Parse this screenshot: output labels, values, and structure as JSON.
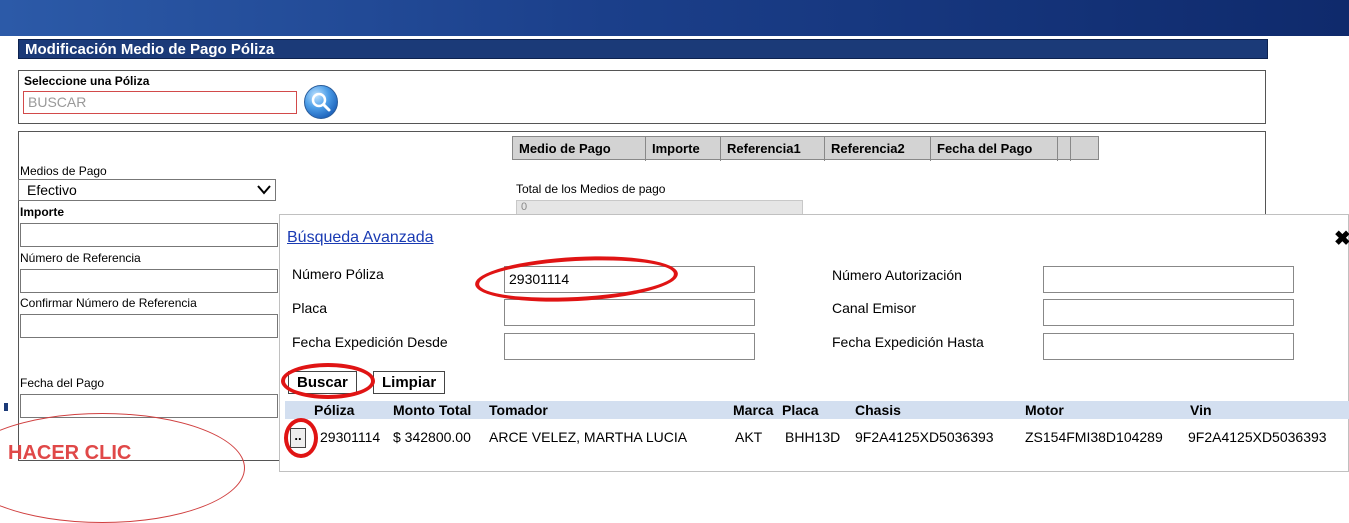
{
  "page_title": "Modificación Medio de Pago Póliza",
  "poliza_select": {
    "label": "Seleccione una Póliza",
    "value": "BUSCAR"
  },
  "left_form": {
    "medios_label": "Medios de Pago",
    "medios_value": "Efectivo",
    "importe_label": "Importe",
    "num_ref_label": "Número de Referencia",
    "confirm_ref_label": "Confirmar Número de Referencia",
    "fecha_label": "Fecha del Pago"
  },
  "payments_table": {
    "headers": [
      "Medio de Pago",
      "Importe",
      "Referencia1",
      "Referencia2",
      "Fecha del Pago"
    ],
    "total_label": "Total de los Medios de pago",
    "total_value": "0"
  },
  "modal": {
    "title": "Búsqueda Avanzada",
    "num_poliza_label": "Número Póliza",
    "num_poliza_value": "29301114",
    "placa_label": "Placa",
    "fecha_desde_label": "Fecha Expedición Desde",
    "num_autorizacion_label": "Número Autorización",
    "canal_label": "Canal Emisor",
    "fecha_hasta_label": "Fecha Expedición Hasta",
    "buscar_label": "Buscar",
    "limpiar_label": "Limpiar"
  },
  "results": {
    "headers": [
      "Póliza",
      "Monto Total",
      "Tomador",
      "Marca",
      "Placa",
      "Chasis",
      "Motor",
      "Vin"
    ],
    "rows": [
      [
        "29301114",
        "$ 342800.00",
        "ARCE VELEZ, MARTHA LUCIA",
        "AKT",
        "BHH13D",
        "9F2A4125XD5036393",
        "ZS154FMI38D104289",
        "9F2A4125XD5036393"
      ]
    ],
    "row_button": ".."
  },
  "annotation": "HACER CLIC",
  "colors": {
    "header_blue": "#1b3a78",
    "annotation_red": "#e01414",
    "link_blue": "#1a3bb3"
  }
}
